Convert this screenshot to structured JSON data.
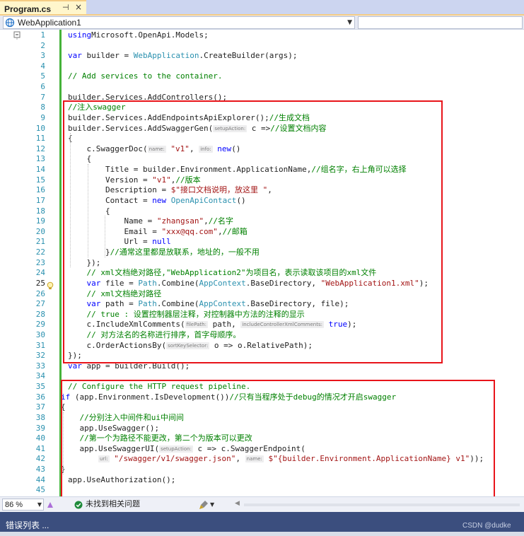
{
  "tab": {
    "title": "Program.cs",
    "pin_glyph": "⊣",
    "close_glyph": "×"
  },
  "nav": {
    "project": "WebApplication1"
  },
  "editor": {
    "current_line": 25,
    "lines": [
      {
        "n": "1",
        "tokens": [
          [
            "kw",
            "using"
          ],
          [
            "",
            "Microsoft.OpenApi.Models;"
          ]
        ]
      },
      {
        "n": "2",
        "tokens": []
      },
      {
        "n": "3",
        "tokens": [
          [
            "kw",
            "var"
          ],
          [
            "",
            " builder = "
          ],
          [
            "ty",
            "WebApplication"
          ],
          [
            "",
            ".CreateBuilder(args);"
          ]
        ]
      },
      {
        "n": "4",
        "tokens": []
      },
      {
        "n": "5",
        "tokens": [
          [
            "cm",
            "// Add services to the container."
          ]
        ]
      },
      {
        "n": "6",
        "tokens": []
      },
      {
        "n": "7",
        "tokens": [
          [
            "",
            "builder.Services.AddControllers();"
          ]
        ]
      },
      {
        "n": "8",
        "tokens": [
          [
            "cm",
            "//注入swagger"
          ]
        ]
      },
      {
        "n": "9",
        "tokens": [
          [
            "",
            "builder.Services.AddEndpointsApiExplorer();"
          ],
          [
            "cm",
            "//生成文档"
          ]
        ]
      },
      {
        "n": "10",
        "tokens": [
          [
            "",
            "builder.Services.AddSwaggerGen("
          ],
          [
            "hint",
            "setupAction:"
          ],
          [
            "",
            " c =>"
          ],
          [
            "cm",
            "//设置文档内容"
          ]
        ]
      },
      {
        "n": "11",
        "tokens": [
          [
            "",
            "{"
          ]
        ]
      },
      {
        "n": "12",
        "tokens": [
          [
            "",
            "    c.SwaggerDoc("
          ],
          [
            "hint",
            "name:"
          ],
          [
            "st",
            " \"v1\""
          ],
          [
            "",
            ", "
          ],
          [
            "hint",
            "info:"
          ],
          [
            "kw",
            " new"
          ],
          [
            "",
            "()"
          ]
        ]
      },
      {
        "n": "13",
        "tokens": [
          [
            "",
            "    {"
          ]
        ]
      },
      {
        "n": "14",
        "tokens": [
          [
            "",
            "        Title = builder.Environment.ApplicationName,"
          ],
          [
            "cm",
            "//组名字，右上角可以选择"
          ]
        ]
      },
      {
        "n": "15",
        "tokens": [
          [
            "",
            "        Version = "
          ],
          [
            "st",
            "\"v1\""
          ],
          [
            "",
            ","
          ],
          [
            "cm",
            "//版本"
          ]
        ]
      },
      {
        "n": "16",
        "tokens": [
          [
            "",
            "        Description = "
          ],
          [
            "st",
            "$\"接口文档说明，放这里 \""
          ],
          [
            "",
            ","
          ]
        ]
      },
      {
        "n": "17",
        "tokens": [
          [
            "",
            "        Contact = "
          ],
          [
            "kw",
            "new"
          ],
          [
            "",
            " "
          ],
          [
            "ty",
            "OpenApiContact"
          ],
          [
            "",
            "()"
          ]
        ]
      },
      {
        "n": "18",
        "tokens": [
          [
            "",
            "        {"
          ]
        ]
      },
      {
        "n": "19",
        "tokens": [
          [
            "",
            "            Name = "
          ],
          [
            "st",
            "\"zhangsan\""
          ],
          [
            "",
            ","
          ],
          [
            "cm",
            "//名字"
          ]
        ]
      },
      {
        "n": "20",
        "tokens": [
          [
            "",
            "            Email = "
          ],
          [
            "st",
            "\"xxx@qq.com\""
          ],
          [
            "",
            ","
          ],
          [
            "cm",
            "//邮箱"
          ]
        ]
      },
      {
        "n": "21",
        "tokens": [
          [
            "",
            "            Url = "
          ],
          [
            "kw",
            "null"
          ]
        ]
      },
      {
        "n": "22",
        "tokens": [
          [
            "",
            "        }"
          ],
          [
            "cm",
            "//通常这里都是放联系，地址的，一般不用"
          ]
        ]
      },
      {
        "n": "23",
        "tokens": [
          [
            "",
            "    });"
          ]
        ]
      },
      {
        "n": "24",
        "tokens": [
          [
            "",
            "    "
          ],
          [
            "cm",
            "// xml文档绝对路径,\"WebApplication2\"为项目名，表示读取该项目的xml文件"
          ]
        ]
      },
      {
        "n": "25",
        "tokens": [
          [
            "",
            "    "
          ],
          [
            "kw",
            "var"
          ],
          [
            "",
            " file = "
          ],
          [
            "ty",
            "Path"
          ],
          [
            "",
            ".Combine("
          ],
          [
            "ty",
            "AppContext"
          ],
          [
            "",
            ".BaseDirectory, "
          ],
          [
            "st",
            "\"WebApplication1.xml\""
          ],
          [
            "",
            ");"
          ]
        ]
      },
      {
        "n": "26",
        "tokens": [
          [
            "",
            "    "
          ],
          [
            "cm",
            "// xml文档绝对路径"
          ]
        ]
      },
      {
        "n": "27",
        "tokens": [
          [
            "",
            "    "
          ],
          [
            "kw",
            "var"
          ],
          [
            "",
            " path = "
          ],
          [
            "ty",
            "Path"
          ],
          [
            "",
            ".Combine("
          ],
          [
            "ty",
            "AppContext"
          ],
          [
            "",
            ".BaseDirectory, file);"
          ]
        ]
      },
      {
        "n": "28",
        "tokens": [
          [
            "",
            "    "
          ],
          [
            "cm",
            "// true : 设置控制器层注释，对控制器中方法的注释的显示"
          ]
        ]
      },
      {
        "n": "29",
        "tokens": [
          [
            "",
            "    c.IncludeXmlComments("
          ],
          [
            "hint",
            "filePath:"
          ],
          [
            "",
            " path, "
          ],
          [
            "hint",
            "includeControllerXmlComments:"
          ],
          [
            "kw",
            " true"
          ],
          [
            "",
            ");"
          ]
        ]
      },
      {
        "n": "30",
        "tokens": [
          [
            "",
            "    "
          ],
          [
            "cm",
            "// 对方法名的名称进行排序，首字母顺序。"
          ]
        ]
      },
      {
        "n": "31",
        "tokens": [
          [
            "",
            "    c.OrderActionsBy("
          ],
          [
            "hint",
            "sortKeySelector:"
          ],
          [
            "",
            " o => o.RelativePath);"
          ]
        ]
      },
      {
        "n": "32",
        "tokens": [
          [
            "",
            "});"
          ]
        ]
      },
      {
        "n": "33",
        "tokens": [
          [
            "kw",
            "var"
          ],
          [
            "",
            " app = builder.Build();"
          ]
        ]
      },
      {
        "n": "34",
        "tokens": []
      },
      {
        "n": "35",
        "tokens": [
          [
            "cm",
            "// Configure the HTTP request pipeline."
          ]
        ]
      },
      {
        "n": "36",
        "tokens": [
          [
            "kw",
            "if"
          ],
          [
            "",
            " (app.Environment.IsDevelopment())"
          ],
          [
            "cm",
            "//只有当程序处于debug的情况才开启swagger"
          ]
        ]
      },
      {
        "n": "37",
        "tokens": [
          [
            "",
            "{"
          ]
        ]
      },
      {
        "n": "38",
        "tokens": [
          [
            "",
            "    "
          ],
          [
            "cm",
            "//分别注入中间件和ui中间间"
          ]
        ]
      },
      {
        "n": "39",
        "tokens": [
          [
            "",
            "    app.UseSwagger();"
          ]
        ]
      },
      {
        "n": "40",
        "tokens": [
          [
            "",
            "    "
          ],
          [
            "cm",
            "//第一个为路径不能更改，第二个为版本可以更改"
          ]
        ]
      },
      {
        "n": "41",
        "tokens": [
          [
            "",
            "    app.UseSwaggerUI("
          ],
          [
            "hint",
            "setupAction:"
          ],
          [
            "",
            " c => c.SwaggerEndpoint("
          ]
        ]
      },
      {
        "n": "42",
        "tokens": [
          [
            "",
            "        "
          ],
          [
            "hint",
            "url:"
          ],
          [
            "st",
            " \"/swagger/v1/swagger.json\""
          ],
          [
            "",
            ", "
          ],
          [
            "hint",
            "name:"
          ],
          [
            "st",
            " $\"{builder.Environment.ApplicationName} v1\""
          ],
          [
            "",
            "));"
          ]
        ]
      },
      {
        "n": "43",
        "tokens": [
          [
            "",
            "}"
          ]
        ]
      },
      {
        "n": "44",
        "tokens": [
          [
            "",
            "app.UseAuthorization();"
          ]
        ]
      },
      {
        "n": "45",
        "tokens": []
      }
    ]
  },
  "status": {
    "zoom": "86 %",
    "issues": "未找到相关问题"
  },
  "panel": {
    "title": "错误列表 ...",
    "watermark": "CSDN @dudke"
  }
}
